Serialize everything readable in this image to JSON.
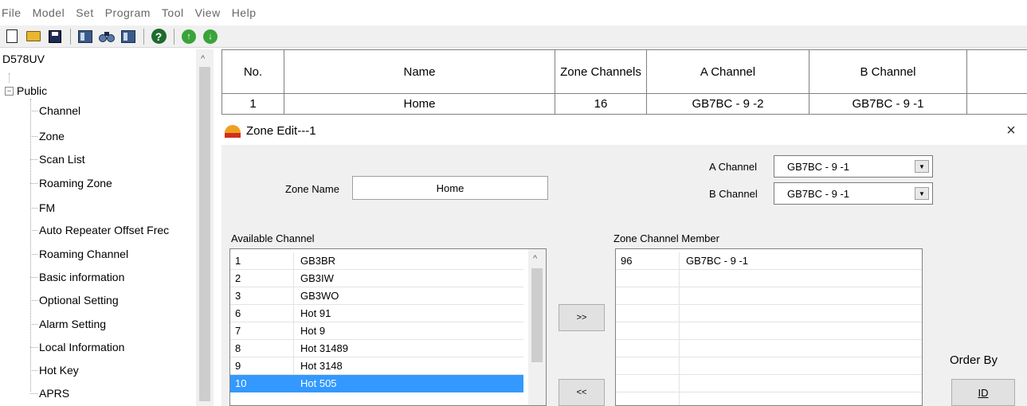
{
  "menu": [
    "File",
    "Model",
    "Set",
    "Program",
    "Tool",
    "View",
    "Help"
  ],
  "toolbar": {
    "icons": [
      "new-file-icon",
      "open-folder-icon",
      "save-icon",
      "read-from-radio-icon",
      "channel-find-icon",
      "write-to-radio-icon",
      "help-icon",
      "upload-icon",
      "download-icon"
    ],
    "help_glyph": "?",
    "up_glyph": "↑",
    "down_glyph": "↓"
  },
  "tree": {
    "root": "D578UV",
    "expander": "−",
    "scroll_up": "^",
    "group": "Public",
    "items": [
      "Channel",
      "Zone",
      "Scan List",
      "Roaming Zone",
      "FM",
      "Auto Repeater Offset Frec",
      "Roaming Channel",
      "Basic information",
      "Optional Setting",
      "Alarm Setting",
      "Local Information",
      "Hot Key",
      "APRS"
    ]
  },
  "grid": {
    "headers": [
      "No.",
      "Name",
      "Zone Channels",
      "A Channel",
      "B Channel",
      ""
    ],
    "rows": [
      [
        "1",
        "Home",
        "16",
        "GB7BC - 9 -2",
        "GB7BC - 9 -1",
        ""
      ]
    ]
  },
  "dialog": {
    "title": "Zone Edit---1",
    "close": "×",
    "zone_name_label": "Zone Name",
    "zone_name_value": "Home",
    "a_channel_label": "A Channel",
    "a_channel_value": "GB7BC - 9 -1",
    "b_channel_label": "B Channel",
    "b_channel_value": "GB7BC - 9 -1",
    "dropdown_glyph": "▼",
    "available_label": "Available Channel",
    "available": [
      {
        "id": "1",
        "name": "GB3BR"
      },
      {
        "id": "2",
        "name": "GB3IW"
      },
      {
        "id": "3",
        "name": "GB3WO"
      },
      {
        "id": "6",
        "name": "Hot  91"
      },
      {
        "id": "7",
        "name": "Hot  9"
      },
      {
        "id": "8",
        "name": "Hot 31489"
      },
      {
        "id": "9",
        "name": "Hot 3148"
      },
      {
        "id": "10",
        "name": "Hot 505"
      }
    ],
    "selected_available_index": 7,
    "available_scroll_up": "^",
    "member_label": "Zone Channel Member",
    "members": [
      {
        "id": "96",
        "name": "GB7BC - 9 -1"
      }
    ],
    "add_button": ">>",
    "remove_button": "<<",
    "order_by_label": "Order By",
    "order_by_button": "ID"
  }
}
